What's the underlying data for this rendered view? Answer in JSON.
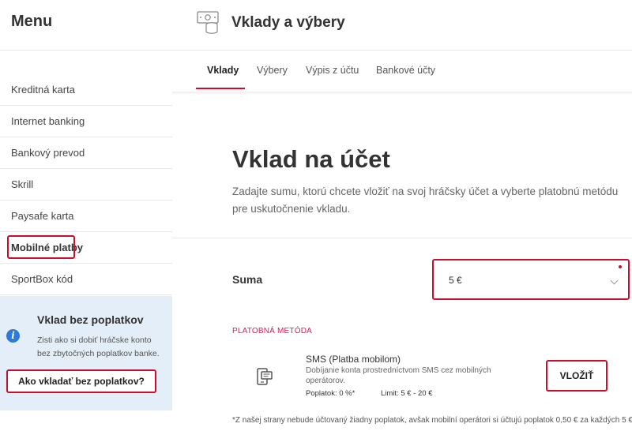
{
  "sidebar": {
    "title": "Menu",
    "items": [
      {
        "label": "Kreditná karta"
      },
      {
        "label": "Internet banking"
      },
      {
        "label": "Bankový prevod"
      },
      {
        "label": "Skrill"
      },
      {
        "label": "Paysafe karta"
      },
      {
        "label": "Mobilné platby",
        "active": true
      },
      {
        "label": "SportBox kód"
      }
    ],
    "promo": {
      "icon": "info-icon",
      "title": "Vklad bez poplatkov",
      "text": "Zisti ako si dobiť hráčske konto bez zbytočných poplatkov banke.",
      "button_label": "Ako vkladať bez poplatkov?"
    }
  },
  "header": {
    "icon": "money-coins-icon",
    "title": "Vklady a výbery"
  },
  "tabs": [
    {
      "label": "Vklady",
      "active": true
    },
    {
      "label": "Výbery"
    },
    {
      "label": "Výpis z účtu"
    },
    {
      "label": "Bankové účty"
    }
  ],
  "content": {
    "title": "Vklad na účet",
    "description": "Zadajte sumu, ktorú chcete vložiť na svoj hráčsky účet a vyberte platobnú metódu pre uskutočnenie vkladu.",
    "amount": {
      "label": "Suma",
      "value": "5 €"
    },
    "payment_method": {
      "section_label": "PLATOBNÁ METÓDA",
      "icon": "mobile-sms-icon",
      "name": "SMS (Platba mobilom)",
      "description": "Dobíjanie konta prostredníctvom SMS cez mobilných operátorov.",
      "fee": "Poplatok: 0 %*",
      "limit": "Limit: 5 € - 20 €",
      "button_label": "VLOŽIŤ"
    },
    "footnote": "*Z našej strany nebude účtovaný žiadny poplatok, avšak mobilní operátori si účtujú poplatok 0,50 € za každých 5 €."
  },
  "colors": {
    "accent": "#c8102e",
    "method_label": "#d81b60",
    "promo_bg": "#e3eef9",
    "info_icon": "#2f7ad6"
  }
}
